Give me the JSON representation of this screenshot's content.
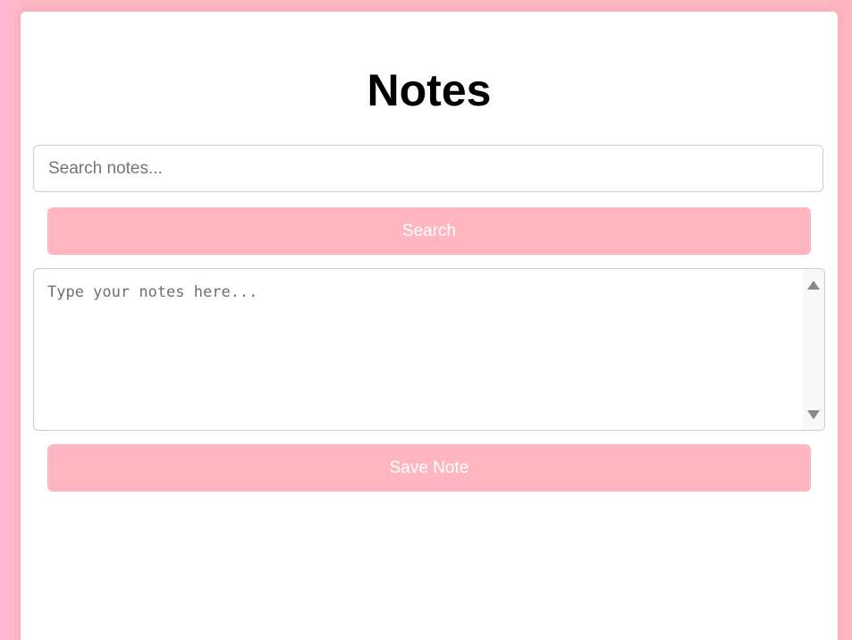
{
  "page": {
    "title": "Notes"
  },
  "search": {
    "placeholder": "Search notes...",
    "value": "",
    "button_label": "Search"
  },
  "editor": {
    "placeholder": "Type your notes here...",
    "value": "",
    "save_label": "Save Note",
    "scrollbar": {
      "up_icon": "triangle-up-icon",
      "down_icon": "triangle-down-icon"
    }
  },
  "colors": {
    "background": "#ffb6c1",
    "button": "#ffb6c1",
    "button_text": "#ffffff",
    "card": "#ffffff",
    "title": "#000000"
  }
}
